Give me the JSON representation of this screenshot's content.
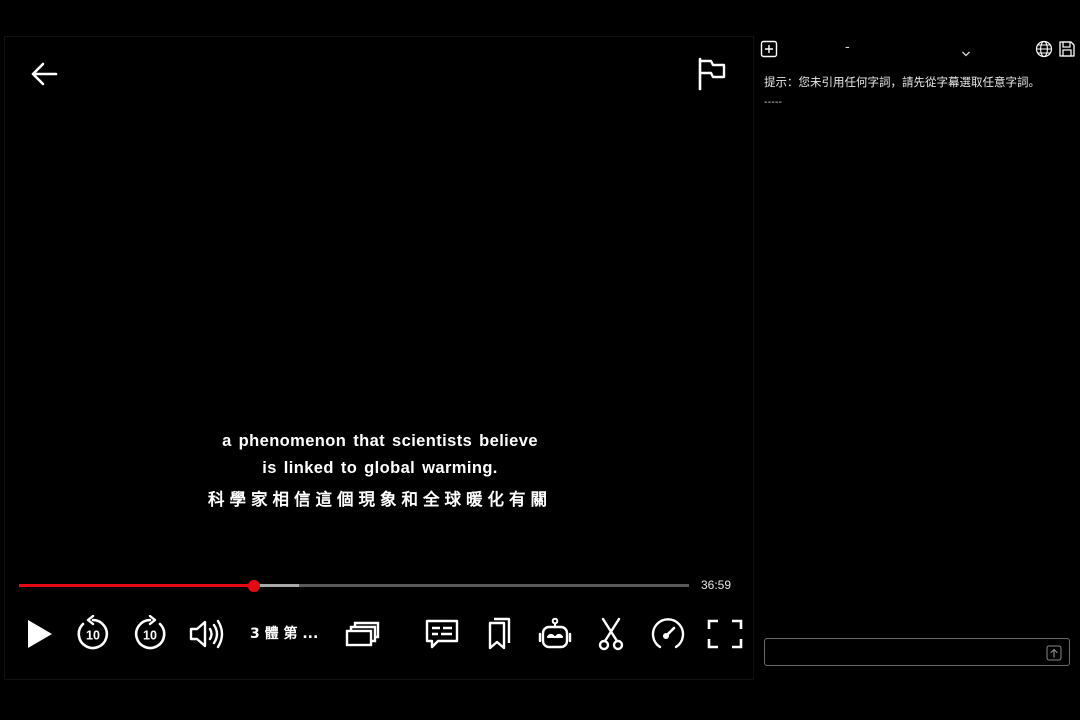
{
  "player": {
    "subtitle_en_line1": "a phenomenon that scientists believe",
    "subtitle_en_line2": "is linked to global warming.",
    "subtitle_zh": "科學家相信這個現象和全球暖化有關",
    "progress": {
      "played_fraction": 0.35,
      "buffered_fraction": 0.418
    },
    "time_remaining": "36:59",
    "episode_title": "3 體 第 ...",
    "icons": {
      "back": "back-arrow-icon",
      "flag": "flag-icon",
      "play": "play-icon",
      "rewind": "rewind-10-icon",
      "forward": "forward-10-icon",
      "volume": "volume-icon",
      "episodes": "episodes-icon",
      "subtitles": "subtitles-icon",
      "bookmark": "bookmark-icon",
      "robot": "robot-icon",
      "clip": "scissors-icon",
      "speed": "speed-icon",
      "fullscreen": "fullscreen-icon"
    },
    "rewind_seconds": "10",
    "forward_seconds": "10",
    "colors": {
      "accent": "#e50914",
      "buffered": "#a9a9a9",
      "track": "#5a5a5a"
    }
  },
  "panel": {
    "select_value": "-",
    "hint": "提示：您未引用任何字詞，請先從字幕選取任意字詞。",
    "divider": "-----",
    "input_value": "",
    "icons": {
      "add": "add-square-icon",
      "dropdown": "chevron-down-icon",
      "globe": "globe-icon",
      "save": "save-icon",
      "send": "send-icon"
    }
  }
}
